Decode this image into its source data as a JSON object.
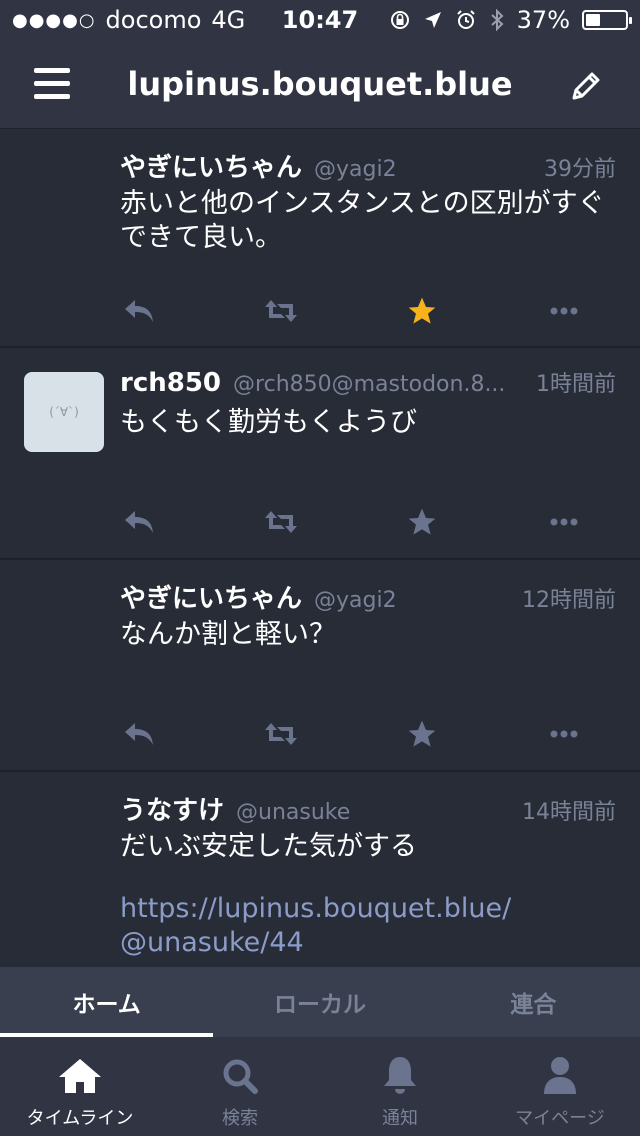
{
  "status_bar": {
    "carrier": "docomo",
    "network": "4G",
    "time": "10:47",
    "battery": "37%",
    "battery_level": 0.37,
    "signal_dots": "●●●●○"
  },
  "nav": {
    "title": "lupinus.bouquet.blue",
    "menu_icon": "hamburger-icon",
    "compose_icon": "pencil-icon"
  },
  "posts": [
    {
      "name": "やぎにいちゃん",
      "handle": "@yagi2",
      "time": "39分前",
      "body": "赤いと他のインスタンスとの区別がすぐできて良い。",
      "favorited": true
    },
    {
      "name": "rch850",
      "handle": "@rch850@mastodon.8...",
      "time": "1時間前",
      "body": "もくもく勤労もくようび",
      "avatar_text": "(´∀`)",
      "favorited": false
    },
    {
      "name": "やぎにいちゃん",
      "handle": "@yagi2",
      "time": "12時間前",
      "body": "なんか割と軽い？",
      "favorited": false
    },
    {
      "name": "うなすけ",
      "handle": "@unasuke",
      "time": "14時間前",
      "body": "だいぶ安定した気がする",
      "link": "https://lupinus.bouquet.blue/@unasuke/44",
      "link_line1": "https://lupinus.bouquet.blue/",
      "link_line2": "@unasuke/44",
      "favorited": false
    }
  ],
  "tabs": [
    {
      "label": "ホーム",
      "active": true
    },
    {
      "label": "ローカル",
      "active": false
    },
    {
      "label": "連合",
      "active": false
    }
  ],
  "bottom_nav": [
    {
      "label": "タイムライン",
      "icon": "home-icon",
      "active": true
    },
    {
      "label": "検索",
      "icon": "search-icon",
      "active": false
    },
    {
      "label": "通知",
      "icon": "bell-icon",
      "active": false
    },
    {
      "label": "マイページ",
      "icon": "user-icon",
      "active": false
    }
  ],
  "colors": {
    "background": "#282c37",
    "bar": "#313543",
    "tab_bar": "#393f4f",
    "muted_text": "#7a8297",
    "icon": "#6a748e",
    "favorite": "#f6b21d",
    "link": "#8c9cc9"
  }
}
